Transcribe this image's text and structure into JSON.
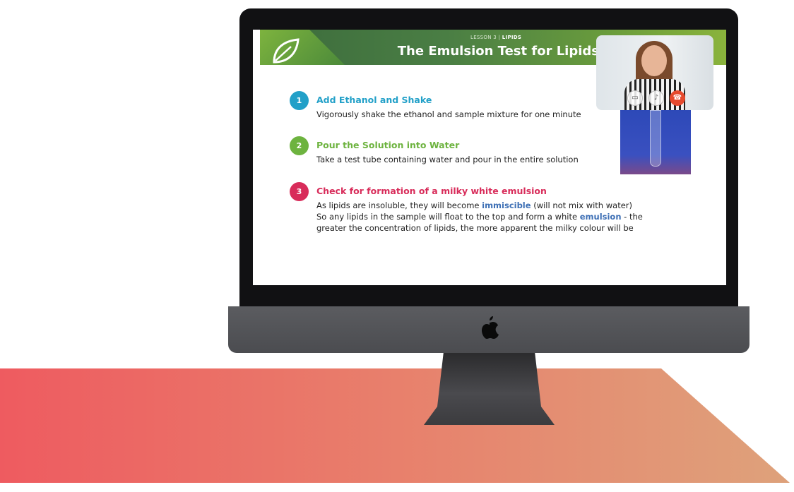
{
  "slide": {
    "lesson_prefix": "LESSON 3",
    "lesson_sep": "|",
    "lesson_topic": "LIPIDS",
    "title": "The Emulsion Test for Lipids"
  },
  "steps": [
    {
      "number": "1",
      "title": "Add Ethanol and Shake",
      "color": "#22a0c8",
      "text": "Vigorously shake the ethanol and sample mixture for one minute"
    },
    {
      "number": "2",
      "title": "Pour the Solution into Water",
      "color": "#6db33f",
      "text": "Take a test tube containing water and pour in the entire solution"
    },
    {
      "number": "3",
      "title": "Check for formation of a milky white emulsion",
      "color": "#d82c5a",
      "line1_a": "As lipids are insoluble, they will become ",
      "line1_hl": "immiscible",
      "line1_b": " (will not mix with water)",
      "line2_a": "So any lipids in the sample will float to the top and form a white ",
      "line2_hl": "emulsion",
      "line2_b": " - the",
      "line3": "greater the concentration of lipids, the more apparent the milky colour will be"
    }
  ],
  "video_call": {
    "buttons": [
      {
        "icon": "chat-icon",
        "glyph": "▭"
      },
      {
        "icon": "mic-icon",
        "glyph": "♪"
      },
      {
        "icon": "end-call-icon",
        "glyph": "☎"
      }
    ]
  },
  "colors": {
    "floor_start": "#ee5b60",
    "floor_end": "#dea27b",
    "highlight": "#3d6fb5",
    "end_call": "#e64a2e"
  }
}
